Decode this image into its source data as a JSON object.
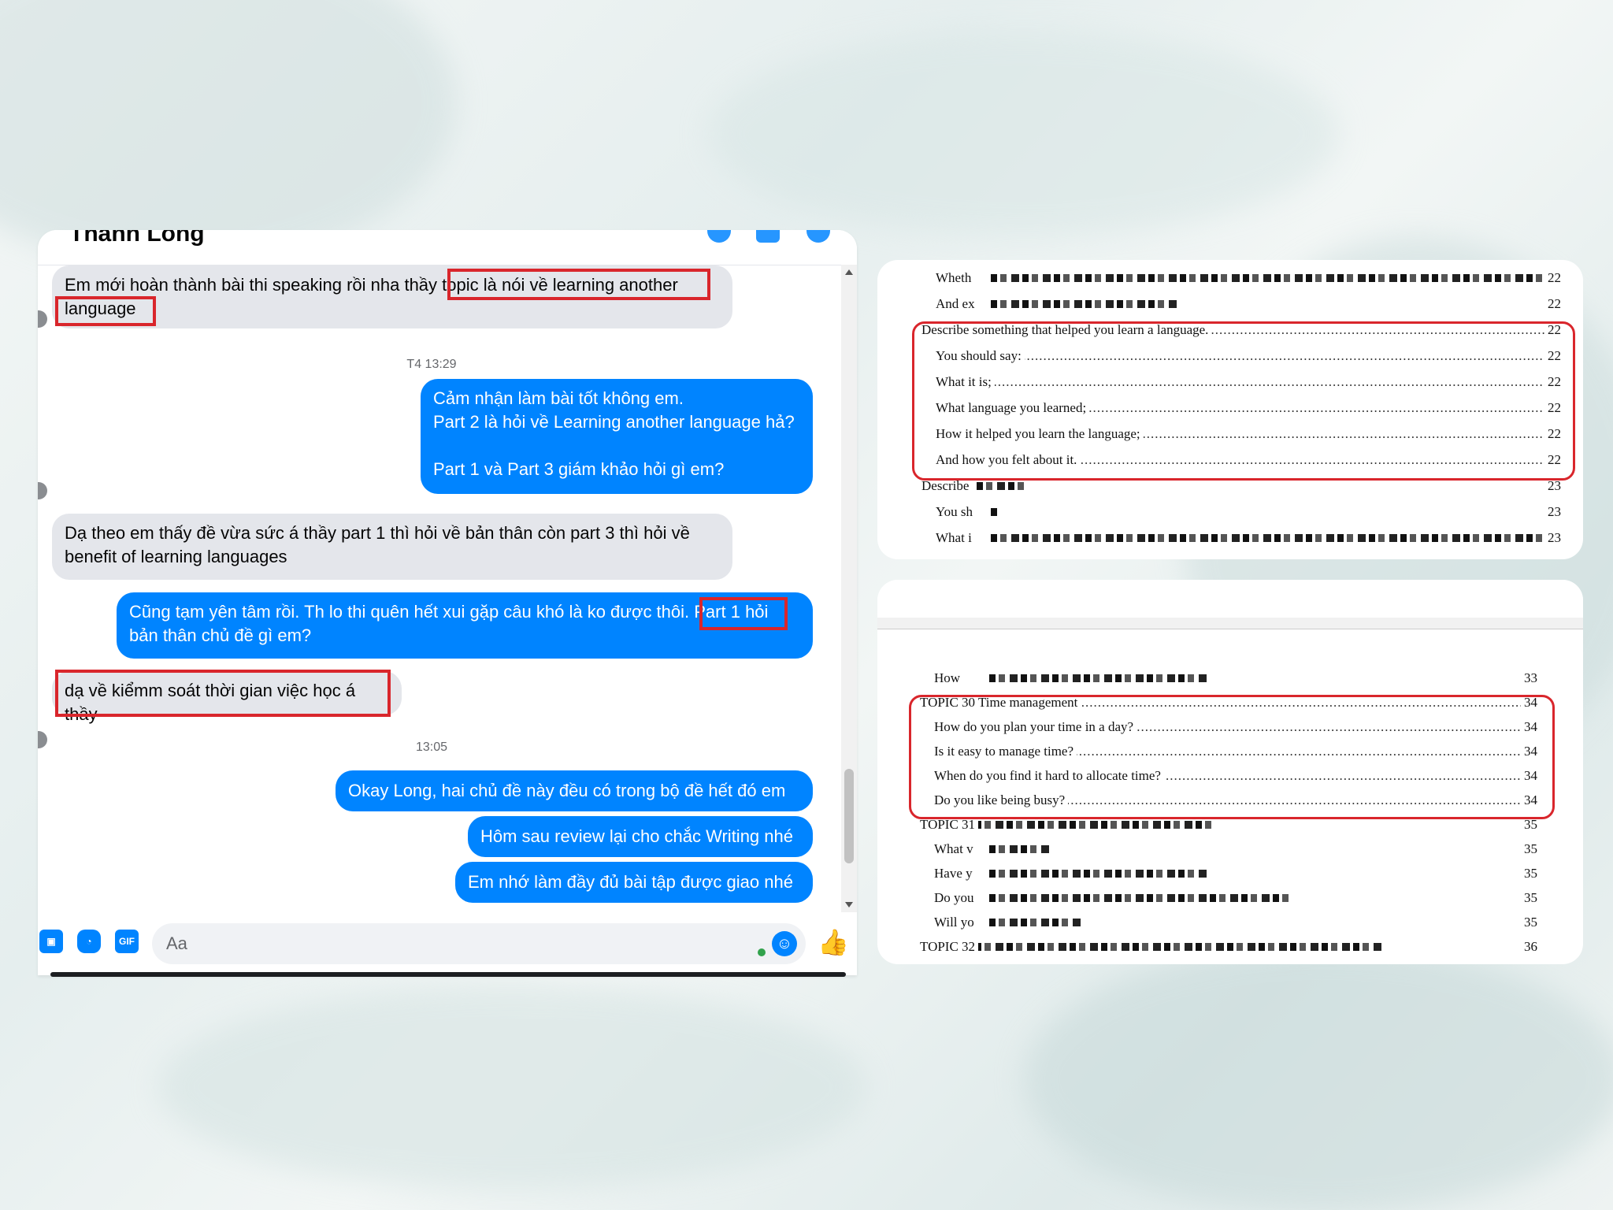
{
  "chat": {
    "contact_name": "Thành Long",
    "messages": [
      {
        "id": "m1",
        "side": "in",
        "text": "Em mới hoàn thành bài thi speaking rồi nha thầy topic là nói về learning another\nlanguage"
      },
      {
        "id": "t1",
        "type": "timestamp",
        "text": "T4 13:29"
      },
      {
        "id": "m2",
        "side": "out",
        "text": "Cảm nhận làm bài tốt không em.\nPart 2 là hỏi về Learning another language hả?\n\nPart 1 và Part 3 giám khảo hỏi gì em?"
      },
      {
        "id": "m3",
        "side": "in",
        "text": "Dạ theo em thấy đề vừa sức á thầy part 1 thì hỏi về bản thân còn part 3 thì hỏi về\nbenefit of learning languages"
      },
      {
        "id": "m4",
        "side": "out",
        "text": "Cũng tạm yên tâm rồi. Th lo thi quên hết xui gặp câu khó là ko được thôi. Part 1 hỏi\nbản thân chủ đề gì em?"
      },
      {
        "id": "m5",
        "side": "in",
        "text": "dạ về kiểmm soát thời gian việc học á thầy"
      },
      {
        "id": "t2",
        "type": "timestamp",
        "text": "13:05"
      },
      {
        "id": "m6",
        "side": "out",
        "text": "Okay Long, hai chủ đề này đều có trong bộ đề hết đó em"
      },
      {
        "id": "m7",
        "side": "out",
        "text": "Hôm sau review lại cho chắc Writing nhé"
      },
      {
        "id": "m8",
        "side": "out",
        "text": "Em nhớ làm đầy đủ bài tập được giao nhé"
      }
    ],
    "composer": {
      "placeholder": "Aa",
      "gif_label": "GIF"
    },
    "icons": [
      "image-icon",
      "sticker-icon",
      "gif-icon",
      "emoji-icon",
      "like-icon"
    ]
  },
  "doc1": {
    "rows": [
      {
        "label": "Wheth",
        "page": "22",
        "indent": 1,
        "redacted": true
      },
      {
        "label": "And ex",
        "page": "22",
        "indent": 1,
        "redacted": true
      },
      {
        "label": "Describe something that helped you learn a language.",
        "page": "22",
        "indent": 0
      },
      {
        "label": "You should say:",
        "page": "22",
        "indent": 1
      },
      {
        "label": "What it is;",
        "page": "22",
        "indent": 1
      },
      {
        "label": "What language you learned;",
        "page": "22",
        "indent": 1
      },
      {
        "label": "How it helped you learn the language;",
        "page": "22",
        "indent": 1
      },
      {
        "label": "And how you felt about it.",
        "page": "22",
        "indent": 1
      },
      {
        "label": "Describe",
        "page": "23",
        "indent": 0,
        "redacted": true
      },
      {
        "label": "You sh",
        "page": "23",
        "indent": 1,
        "redacted": true
      },
      {
        "label": "What i",
        "page": "23",
        "indent": 1,
        "redacted": true
      }
    ]
  },
  "doc2": {
    "rows": [
      {
        "label": "How",
        "page": "33",
        "indent": 1,
        "redacted": true
      },
      {
        "label": "TOPIC 30 Time management",
        "page": "34",
        "indent": 0
      },
      {
        "label": "How do you plan your time in a day?",
        "page": "34",
        "indent": 1
      },
      {
        "label": "Is it easy to manage time?",
        "page": "34",
        "indent": 1
      },
      {
        "label": "When do you find it hard to allocate time?",
        "page": "34",
        "indent": 1
      },
      {
        "label": "Do you like being busy?",
        "page": "34",
        "indent": 1
      },
      {
        "label": "TOPIC 31",
        "page": "35",
        "indent": 0,
        "redacted": true
      },
      {
        "label": "What v",
        "page": "35",
        "indent": 1,
        "redacted": true
      },
      {
        "label": "Have y",
        "page": "35",
        "indent": 1,
        "redacted": true
      },
      {
        "label": "Do you",
        "page": "35",
        "indent": 1,
        "redacted": true
      },
      {
        "label": "Will yo",
        "page": "35",
        "indent": 1,
        "redacted": true
      },
      {
        "label": "TOPIC 32",
        "page": "36",
        "indent": 0,
        "redacted": true
      }
    ]
  },
  "colors": {
    "accent_blue": "#0084ff",
    "highlight_red": "#d9262c",
    "incoming_gray": "#e4e6eb"
  }
}
